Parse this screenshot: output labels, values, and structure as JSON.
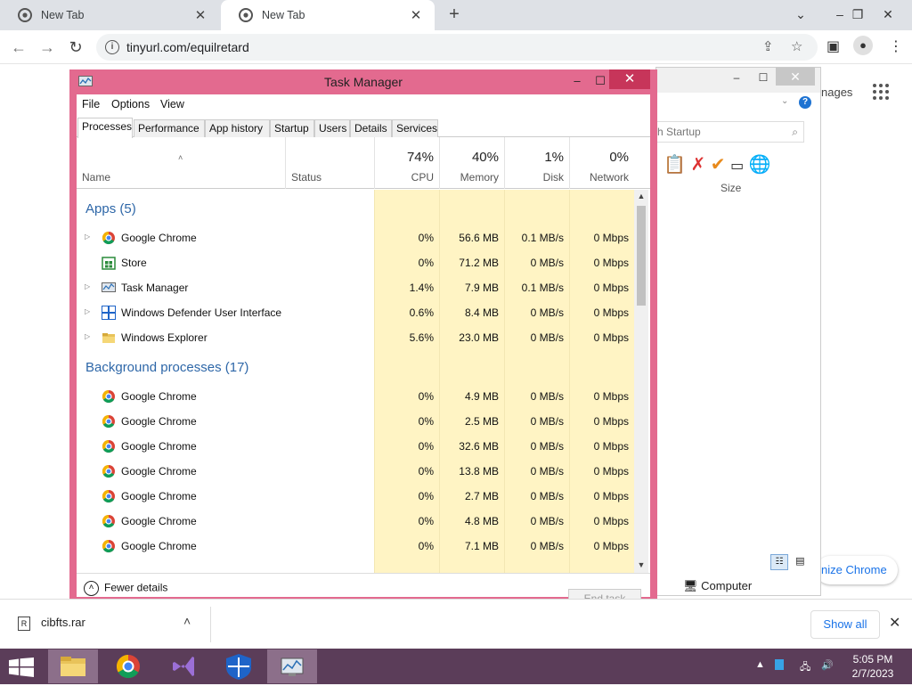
{
  "browser": {
    "tabs": [
      {
        "title": "New Tab",
        "active": false
      },
      {
        "title": "New Tab",
        "active": true
      }
    ],
    "url": "tinyurl.com/equilretard"
  },
  "background_page": {
    "images_link": "nages",
    "customize_button": "nize Chrome"
  },
  "explorer_window": {
    "search_placeholder": "h Startup",
    "size_column": "Size",
    "status_location": "Computer"
  },
  "task_manager": {
    "title": "Task Manager",
    "menu": [
      "File",
      "Options",
      "View"
    ],
    "tabs": [
      "Processes",
      "Performance",
      "App history",
      "Startup",
      "Users",
      "Details",
      "Services"
    ],
    "active_tab": "Processes",
    "columns": {
      "name": "Name",
      "status": "Status",
      "cpu": {
        "label": "CPU",
        "pct": "74%"
      },
      "memory": {
        "label": "Memory",
        "pct": "40%"
      },
      "disk": {
        "label": "Disk",
        "pct": "1%"
      },
      "network": {
        "label": "Network",
        "pct": "0%"
      }
    },
    "groups": [
      {
        "title": "Apps (5)",
        "rows": [
          {
            "name": "Google Chrome",
            "icon": "chrome-icon",
            "expandable": true,
            "cpu": "0%",
            "memory": "56.6 MB",
            "disk": "0.1 MB/s",
            "network": "0 Mbps"
          },
          {
            "name": "Store",
            "icon": "store-icon",
            "expandable": false,
            "cpu": "0%",
            "memory": "71.2 MB",
            "disk": "0 MB/s",
            "network": "0 Mbps"
          },
          {
            "name": "Task Manager",
            "icon": "task-manager-icon",
            "expandable": true,
            "cpu": "1.4%",
            "memory": "7.9 MB",
            "disk": "0.1 MB/s",
            "network": "0 Mbps"
          },
          {
            "name": "Windows Defender User Interface",
            "icon": "defender-icon",
            "expandable": true,
            "cpu": "0.6%",
            "memory": "8.4 MB",
            "disk": "0 MB/s",
            "network": "0 Mbps"
          },
          {
            "name": "Windows Explorer",
            "icon": "explorer-icon",
            "expandable": true,
            "cpu": "5.6%",
            "memory": "23.0 MB",
            "disk": "0 MB/s",
            "network": "0 Mbps"
          }
        ]
      },
      {
        "title": "Background processes (17)",
        "rows": [
          {
            "name": "Google Chrome",
            "icon": "chrome-icon",
            "expandable": false,
            "cpu": "0%",
            "memory": "4.9 MB",
            "disk": "0 MB/s",
            "network": "0 Mbps"
          },
          {
            "name": "Google Chrome",
            "icon": "chrome-icon",
            "expandable": false,
            "cpu": "0%",
            "memory": "2.5 MB",
            "disk": "0 MB/s",
            "network": "0 Mbps"
          },
          {
            "name": "Google Chrome",
            "icon": "chrome-icon",
            "expandable": false,
            "cpu": "0%",
            "memory": "32.6 MB",
            "disk": "0 MB/s",
            "network": "0 Mbps"
          },
          {
            "name": "Google Chrome",
            "icon": "chrome-icon",
            "expandable": false,
            "cpu": "0%",
            "memory": "13.8 MB",
            "disk": "0 MB/s",
            "network": "0 Mbps"
          },
          {
            "name": "Google Chrome",
            "icon": "chrome-icon",
            "expandable": false,
            "cpu": "0%",
            "memory": "2.7 MB",
            "disk": "0 MB/s",
            "network": "0 Mbps"
          },
          {
            "name": "Google Chrome",
            "icon": "chrome-icon",
            "expandable": false,
            "cpu": "0%",
            "memory": "4.8 MB",
            "disk": "0 MB/s",
            "network": "0 Mbps"
          },
          {
            "name": "Google Chrome",
            "icon": "chrome-icon",
            "expandable": false,
            "cpu": "0%",
            "memory": "7.1 MB",
            "disk": "0 MB/s",
            "network": "0 Mbps"
          }
        ]
      }
    ],
    "fewer_details": "Fewer details",
    "end_task": "End task"
  },
  "download_bar": {
    "file_name": "cibfts.rar",
    "show_all": "Show all"
  },
  "taskbar": {
    "items": [
      "file-explorer-icon",
      "chrome-icon",
      "visual-studio-icon",
      "defender-icon",
      "task-manager-icon"
    ],
    "time": "5:05 PM",
    "date": "2/7/2023"
  },
  "colors": {
    "task_manager_frame": "#e36a8f",
    "close_button": "#c7355a",
    "group_title": "#2e67a8",
    "heat_cells": "#fff4c4",
    "taskbar": "#5b3d59"
  }
}
